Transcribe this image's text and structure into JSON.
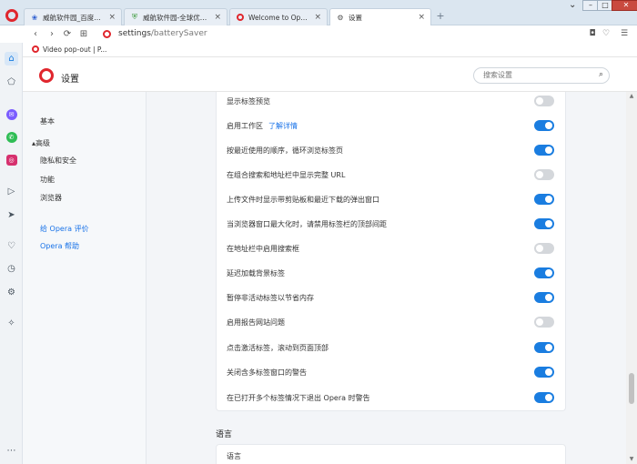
{
  "tabs": [
    {
      "title": "威航软件园_百度搜索",
      "icon": "paw-icon"
    },
    {
      "title": "威航软件园-全球优质精品软件下载",
      "icon": "shield-icon"
    },
    {
      "title": "Welcome to Opera",
      "icon": "opera-icon"
    },
    {
      "title": "设置",
      "icon": "gear-icon"
    }
  ],
  "address": {
    "host": "settings",
    "path": "/batterySaver"
  },
  "bookmarks": [
    {
      "label": "Video pop-out | P..."
    }
  ],
  "settings": {
    "title": "设置",
    "search_placeholder": "搜索设置"
  },
  "nav": {
    "basic": "基本",
    "advanced": "▴高级",
    "privacy": "隐私和安全",
    "features": "功能",
    "browser": "浏览器",
    "rate": "给 Opera 评价",
    "help": "Opera 帮助"
  },
  "rows": [
    {
      "label": "显示标签预览",
      "link": "",
      "on": false
    },
    {
      "label": "启用工作区",
      "link": "了解详情",
      "on": true
    },
    {
      "label": "按最近使用的顺序，循环浏览标签页",
      "link": "",
      "on": true
    },
    {
      "label": "在组合搜索和地址栏中显示完整 URL",
      "link": "",
      "on": false
    },
    {
      "label": "上传文件时显示带剪贴板和最近下载的弹出窗口",
      "link": "",
      "on": true
    },
    {
      "label": "当浏览器窗口最大化时，请禁用标签栏的顶部间距",
      "link": "",
      "on": true
    },
    {
      "label": "在地址栏中启用搜索框",
      "link": "",
      "on": false
    },
    {
      "label": "延迟加载背景标签",
      "link": "",
      "on": true
    },
    {
      "label": "暂停非活动标签以节省内存",
      "link": "",
      "on": true
    },
    {
      "label": "启用报告网站问题",
      "link": "",
      "on": false
    },
    {
      "label": "点击激活标签，滚动到页面顶部",
      "link": "",
      "on": true
    },
    {
      "label": "关闭含多标签窗口的警告",
      "link": "",
      "on": true
    },
    {
      "label": "在已打开多个标签情况下退出 Opera 时警告",
      "link": "",
      "on": true
    }
  ],
  "language": {
    "section": "语言",
    "row_label": "语言"
  },
  "colors": {
    "accent": "#1a7de0",
    "toggle_off": "#d4d7db",
    "opera_red": "#e0262d",
    "link": "#1a73e8"
  }
}
